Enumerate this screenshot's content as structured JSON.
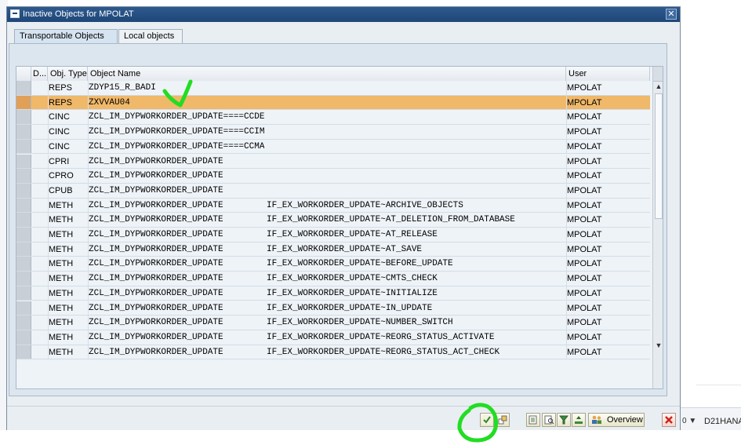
{
  "window": {
    "title": "Inactive Objects for MPOLAT",
    "close_symbol": "✕"
  },
  "tabs": [
    {
      "label": "Transportable Objects",
      "active": true
    },
    {
      "label": "Local objects",
      "active": false
    }
  ],
  "table": {
    "columns": [
      "D...",
      "Obj. Type",
      "Object Name",
      "User"
    ],
    "rows": [
      {
        "type": "REPS",
        "name": "ZDYP15_R_BADI",
        "sub": "",
        "user": "MPOLAT",
        "selected": false
      },
      {
        "type": "REPS",
        "name": "ZXVVAU04",
        "sub": "",
        "user": "MPOLAT",
        "selected": true
      },
      {
        "type": "CINC",
        "name": "ZCL_IM_DYPWORKORDER_UPDATE====CCDEF",
        "sub": "",
        "user": "MPOLAT",
        "selected": false
      },
      {
        "type": "CINC",
        "name": "ZCL_IM_DYPWORKORDER_UPDATE====CCIMP",
        "sub": "",
        "user": "MPOLAT",
        "selected": false
      },
      {
        "type": "CINC",
        "name": "ZCL_IM_DYPWORKORDER_UPDATE====CCMAC",
        "sub": "",
        "user": "MPOLAT",
        "selected": false
      },
      {
        "type": "CPRI",
        "name": "ZCL_IM_DYPWORKORDER_UPDATE",
        "sub": "",
        "user": "MPOLAT",
        "selected": false
      },
      {
        "type": "CPRO",
        "name": "ZCL_IM_DYPWORKORDER_UPDATE",
        "sub": "",
        "user": "MPOLAT",
        "selected": false
      },
      {
        "type": "CPUB",
        "name": "ZCL_IM_DYPWORKORDER_UPDATE",
        "sub": "",
        "user": "MPOLAT",
        "selected": false
      },
      {
        "type": "METH",
        "name": "ZCL_IM_DYPWORKORDER_UPDATE",
        "sub": "IF_EX_WORKORDER_UPDATE~ARCHIVE_OBJECTS",
        "user": "MPOLAT",
        "selected": false
      },
      {
        "type": "METH",
        "name": "ZCL_IM_DYPWORKORDER_UPDATE",
        "sub": "IF_EX_WORKORDER_UPDATE~AT_DELETION_FROM_DATABASE",
        "user": "MPOLAT",
        "selected": false
      },
      {
        "type": "METH",
        "name": "ZCL_IM_DYPWORKORDER_UPDATE",
        "sub": "IF_EX_WORKORDER_UPDATE~AT_RELEASE",
        "user": "MPOLAT",
        "selected": false
      },
      {
        "type": "METH",
        "name": "ZCL_IM_DYPWORKORDER_UPDATE",
        "sub": "IF_EX_WORKORDER_UPDATE~AT_SAVE",
        "user": "MPOLAT",
        "selected": false
      },
      {
        "type": "METH",
        "name": "ZCL_IM_DYPWORKORDER_UPDATE",
        "sub": "IF_EX_WORKORDER_UPDATE~BEFORE_UPDATE",
        "user": "MPOLAT",
        "selected": false
      },
      {
        "type": "METH",
        "name": "ZCL_IM_DYPWORKORDER_UPDATE",
        "sub": "IF_EX_WORKORDER_UPDATE~CMTS_CHECK",
        "user": "MPOLAT",
        "selected": false
      },
      {
        "type": "METH",
        "name": "ZCL_IM_DYPWORKORDER_UPDATE",
        "sub": "IF_EX_WORKORDER_UPDATE~INITIALIZE",
        "user": "MPOLAT",
        "selected": false
      },
      {
        "type": "METH",
        "name": "ZCL_IM_DYPWORKORDER_UPDATE",
        "sub": "IF_EX_WORKORDER_UPDATE~IN_UPDATE",
        "user": "MPOLAT",
        "selected": false
      },
      {
        "type": "METH",
        "name": "ZCL_IM_DYPWORKORDER_UPDATE",
        "sub": "IF_EX_WORKORDER_UPDATE~NUMBER_SWITCH",
        "user": "MPOLAT",
        "selected": false
      },
      {
        "type": "METH",
        "name": "ZCL_IM_DYPWORKORDER_UPDATE",
        "sub": "IF_EX_WORKORDER_UPDATE~REORG_STATUS_ACTIVATE",
        "user": "MPOLAT",
        "selected": false
      },
      {
        "type": "METH",
        "name": "ZCL_IM_DYPWORKORDER_UPDATE",
        "sub": "IF_EX_WORKORDER_UPDATE~REORG_STATUS_ACT_CHECK",
        "user": "MPOLAT",
        "selected": false
      }
    ]
  },
  "scrollbar": {
    "up_symbol": "▲",
    "down_symbol": "▼"
  },
  "toolbar": {
    "buttons": [
      {
        "name": "continue-button",
        "icon": "checkmark-icon"
      },
      {
        "name": "select-all-button",
        "icon": "select-all-icon"
      },
      {
        "name": "details-button",
        "icon": "details-icon"
      },
      {
        "name": "find-button",
        "icon": "find-icon"
      },
      {
        "name": "filter-button",
        "icon": "filter-icon"
      },
      {
        "name": "sort-button",
        "icon": "sort-icon"
      }
    ],
    "overview_label": "Overview",
    "cancel_symbol": "✖"
  },
  "background": {
    "status_arrow": "0 ▼",
    "system_label": "D21HANA"
  },
  "colors": {
    "title_bar": "#1f4778",
    "selected_row": "#f0b869",
    "annotation_green": "#22dd22"
  }
}
